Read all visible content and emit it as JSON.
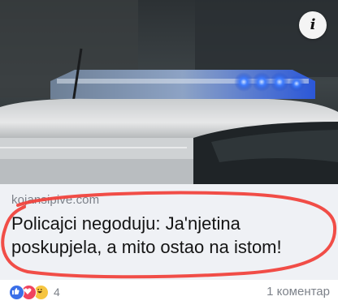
{
  "link_preview": {
    "domain": "kojansipive.com",
    "headline_line1": "Policajci negoduju: Ja'njetina",
    "headline_line2": "poskupjela, a mito ostao na istom!",
    "image_icon": "police-car-image",
    "info_icon": "info-icon"
  },
  "footer": {
    "reaction_count": "4",
    "comment_count": "1 коментар",
    "reactions": [
      "like-icon",
      "love-icon",
      "haha-icon"
    ]
  },
  "colors": {
    "card_background": "#eff1f5",
    "annotation_circle": "#f0433d",
    "siren_blue": "#2f6cff",
    "muted_text": "#7d828a"
  }
}
